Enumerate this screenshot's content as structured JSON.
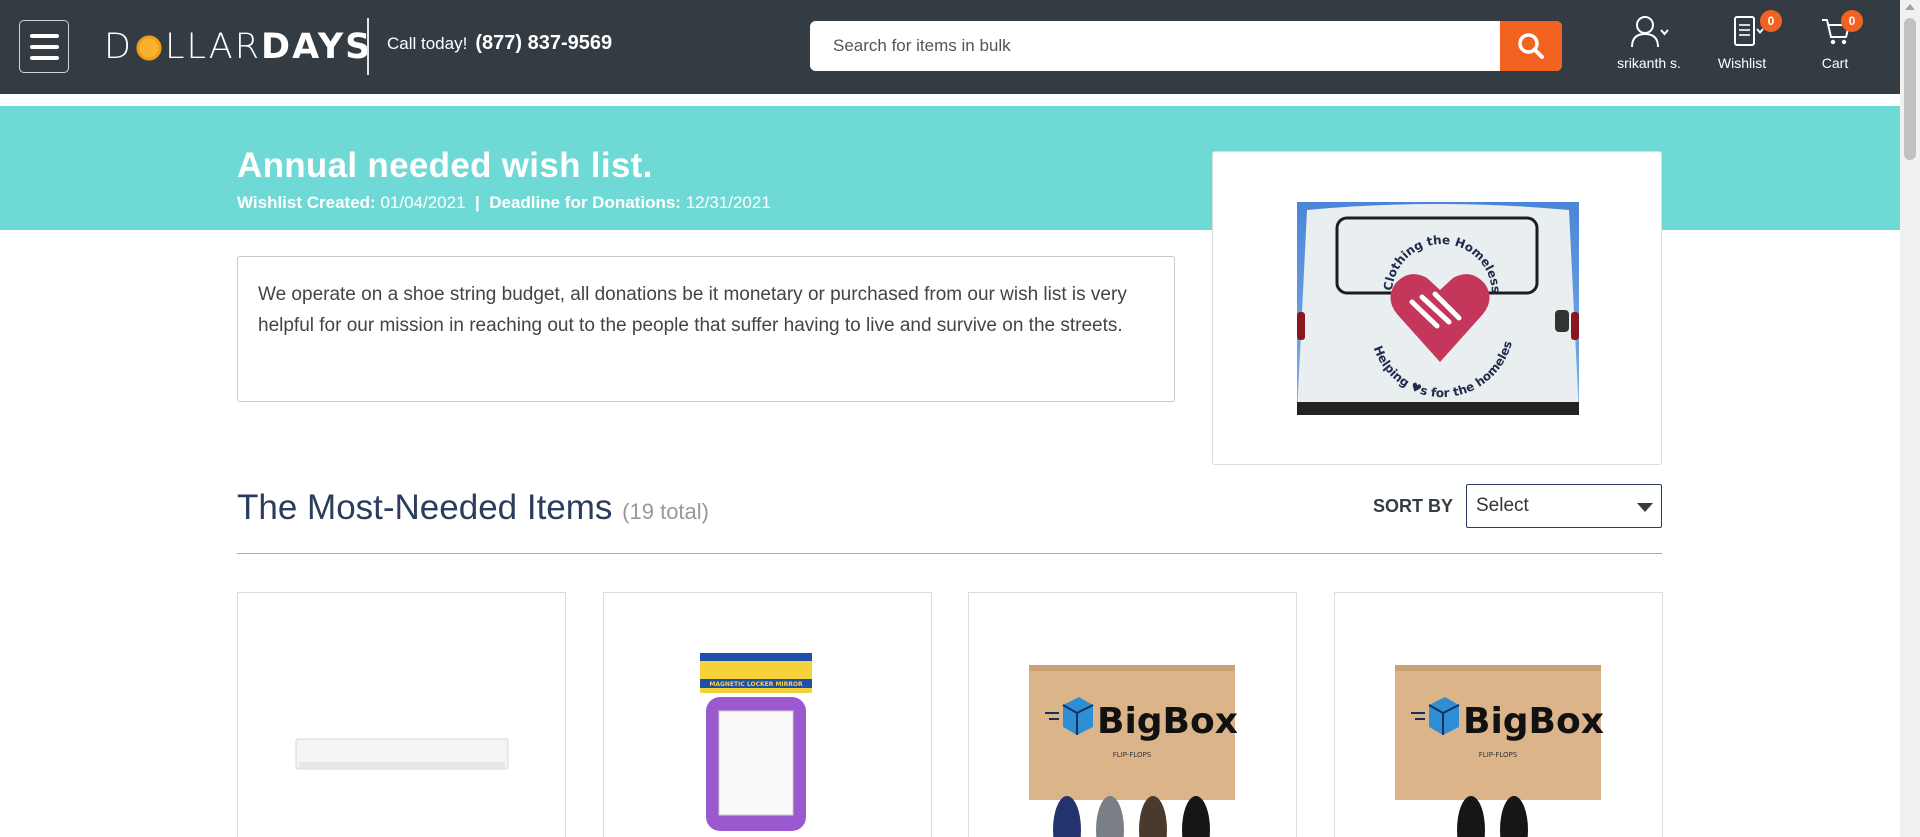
{
  "header": {
    "logo_text_pre": "D",
    "logo_text_mid": "LLAR",
    "logo_text_bold": "DAYS",
    "call_label": "Call today!",
    "phone": "(877) 837-9569",
    "search_placeholder": "Search for items in bulk",
    "user_label": "srikanth s.",
    "wishlist_label": "Wishlist",
    "wishlist_count": "0",
    "cart_label": "Cart",
    "cart_count": "0",
    "accent_color": "#f26322",
    "bg_color": "#333c43"
  },
  "wishlist": {
    "title": "Annual needed wish list.",
    "created_label": "Wishlist Created:",
    "created_date": "01/04/2021",
    "separator": "|",
    "deadline_label": "Deadline for Donations:",
    "deadline_date": "12/31/2021",
    "description": "We operate on a shoe string budget, all donations be it monetary or purchased from our wish list is very helpful for our mission in reaching out to the people that suffer having to live and survive on the streets.",
    "image_text_top": "Clothing the Homeless.org",
    "image_text_bottom": "Helping ♥s for the homeless",
    "banner_color": "#6fdad5"
  },
  "section": {
    "title": "The Most-Needed Items",
    "count": "(19 total)",
    "sort_label": "SORT BY",
    "sort_value": "Select"
  },
  "products": [
    {
      "icon": "white-strip-product-image"
    },
    {
      "icon": "magnetic-locker-mirror-image",
      "label": "MAGNETIC LOCKER MIRROR"
    },
    {
      "icon": "bigbox-flip-flops-image",
      "brand": "BigBox",
      "sub": "FLIP-FLOPS"
    },
    {
      "icon": "bigbox-flip-flops-image",
      "brand": "BigBox",
      "sub": "FLIP-FLOPS"
    }
  ]
}
